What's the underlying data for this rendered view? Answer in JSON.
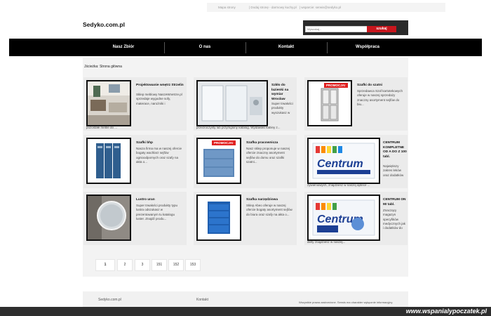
{
  "topbar": {
    "link1": "Mapa strony",
    "link2": "| Dodaj stronę - darmowy kuchy.pl",
    "link3": "| wsparcie: serwis@sedyko.pl"
  },
  "header": {
    "logo": "Sedyko.com.pl"
  },
  "search": {
    "placeholder": "Wyszukaj...",
    "button": "szukaj"
  },
  "nav": {
    "items": [
      "Nasz Zbiór",
      "O nas",
      "Kontakt",
      "Współpraca"
    ]
  },
  "breadcrumb": "Jścieżka: Strona główna",
  "cards": [
    {
      "title": "Projektowanie wnętrz Strzelin",
      "desc": "Sklep meblowy NaszeWnetrze.pl sprzedaje wygodne sofy, materace, narożniki i",
      "extra": "pozostałe meble do ...",
      "promo": ""
    },
    {
      "title": "Szkło do łazienki na wymiar Wrocław",
      "desc": "Super trwałości produkty wyszukasz w",
      "extra": "przezroczysty lub przymglony katalog. Wydawało kabiny z...",
      "promo": ""
    },
    {
      "title": "Szafki do szatni",
      "desc": "Sprzedawca Szaf kartotekowych oferuje w naszej sprzedaży znaczny asortyment sejfów do biu...",
      "extra": "",
      "promo": "PROMOCJA!"
    },
    {
      "title": "Szafki bhp",
      "desc": "Nasza firma ma w naszej ofercie bogaty wachlarz sejfów ognioodpornych oraz szafy na akta o...",
      "extra": "",
      "promo": ""
    },
    {
      "title": "Szafka pracownicza",
      "desc": "Nasz sklep proponuje w naszej ofercie znaczny asortyment sejfów do domu oraz szafki szatni...",
      "extra": "",
      "promo": "PROMOCJA!"
    },
    {
      "title": "CENTRUM KOMPLETNE OD A DO Z 100 tabl.",
      "desc": "Największy zakres leków oraz dodatków",
      "extra": "żywieniowych, znajdziesz w naszej aptece ...",
      "promo": ""
    },
    {
      "title": "Lustro uran",
      "desc": "Super trwałości produkty typu lustra odszukasz w prezentowanym tu katalogu luster. Znajdź produ...",
      "extra": "",
      "promo": ""
    },
    {
      "title": "Szafka narzędziowa",
      "desc": "Sklep Abeo oferuje w naszej ofercie bogaty asortyment sejfów do biura oraz szafy na akta o...",
      "extra": "",
      "promo": ""
    },
    {
      "title": "CENTRUM ON 90 tabl.",
      "desc": "Znaczący magazyn specyfików medycznych jak i dodatków do",
      "extra": "diety znajdziesz w naszej...",
      "promo": ""
    }
  ],
  "pagination": [
    "1",
    "2",
    "3",
    "151",
    "152",
    "153"
  ],
  "footer": {
    "left": "Sedyko.com.pl",
    "mid": "Kontakt",
    "right": "Wszystkie prawa zastrzeżone. Serwis ma charakter wyłącznie informacyjny."
  },
  "watermark": "www.wspanialypoczatek.pl",
  "colors": {
    "nav_bg": "#000000",
    "accent": "#c8161d",
    "card_bg": "#ebebeb"
  }
}
